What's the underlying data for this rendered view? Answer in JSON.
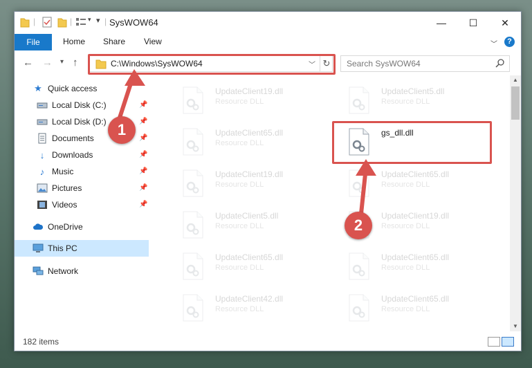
{
  "window": {
    "title": "SysWOW64",
    "minimize": "—",
    "maximize": "☐",
    "close": "✕"
  },
  "ribbon": {
    "file": "File",
    "home": "Home",
    "share": "Share",
    "view": "View",
    "help": "?"
  },
  "address": {
    "path": "C:\\Windows\\SysWOW64",
    "search_placeholder": "Search SysWOW64"
  },
  "sidebar": {
    "items": [
      {
        "label": "Quick access",
        "icon": "star-icon"
      },
      {
        "label": "Local Disk (C:)",
        "icon": "drive-icon"
      },
      {
        "label": "Local Disk (D:)",
        "icon": "drive-icon"
      },
      {
        "label": "Documents",
        "icon": "documents-icon"
      },
      {
        "label": "Downloads",
        "icon": "download-icon"
      },
      {
        "label": "Music",
        "icon": "music-icon"
      },
      {
        "label": "Pictures",
        "icon": "pictures-icon"
      },
      {
        "label": "Videos",
        "icon": "videos-icon"
      },
      {
        "label": "OneDrive",
        "icon": "cloud-icon"
      },
      {
        "label": "This PC",
        "icon": "computer-icon"
      },
      {
        "label": "Network",
        "icon": "network-icon"
      }
    ]
  },
  "files": {
    "left": [
      {
        "name": "UpdateClient19.dll",
        "desc": "Resource DLL"
      },
      {
        "name": "UpdateClient65.dll",
        "desc": "Resource DLL"
      },
      {
        "name": "UpdateClient19.dll",
        "desc": "Resource DLL"
      },
      {
        "name": "UpdateClient5.dll",
        "desc": "Resource DLL"
      },
      {
        "name": "UpdateClient65.dll",
        "desc": "Resource DLL"
      },
      {
        "name": "UpdateClient42.dll",
        "desc": "Resource DLL"
      }
    ],
    "right": [
      {
        "name": "UpdateClient5.dll",
        "desc": "Resource DLL"
      },
      {
        "name": "gs_dll.dll",
        "desc": ""
      },
      {
        "name": "UpdateClient65.dll",
        "desc": "Resource DLL"
      },
      {
        "name": "UpdateClient19.dll",
        "desc": "Resource DLL"
      },
      {
        "name": "UpdateClient65.dll",
        "desc": "Resource DLL"
      },
      {
        "name": "UpdateClient65.dll",
        "desc": "Resource DLL"
      }
    ]
  },
  "status": {
    "items_count": "182 items"
  },
  "callouts": {
    "one": "1",
    "two": "2",
    "accent": "#d9534f"
  }
}
